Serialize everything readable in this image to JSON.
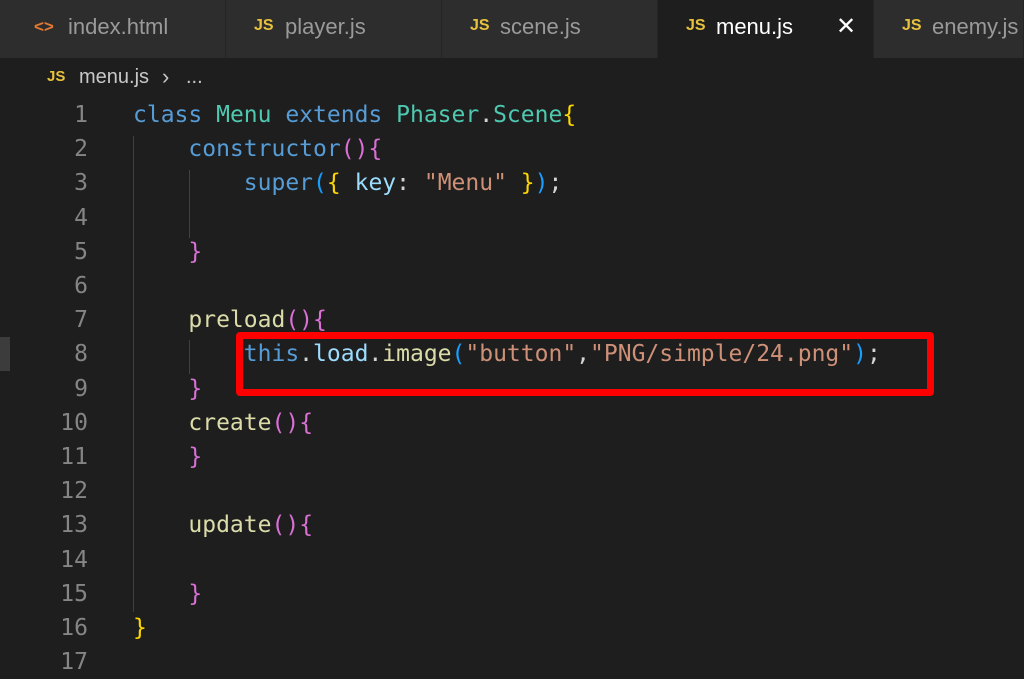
{
  "tabs": [
    {
      "label": "index.html",
      "icon": "<>",
      "icon_name": "html-file-icon"
    },
    {
      "label": "player.js",
      "icon": "JS",
      "icon_name": "js-file-icon"
    },
    {
      "label": "scene.js",
      "icon": "JS",
      "icon_name": "js-file-icon"
    },
    {
      "label": "menu.js",
      "icon": "JS",
      "icon_name": "js-file-icon",
      "active": true,
      "close": "✕"
    },
    {
      "label": "enemy.js",
      "icon": "JS",
      "icon_name": "js-file-icon"
    }
  ],
  "breadcrumb": {
    "icon": "JS",
    "file": "menu.js",
    "separator": "›",
    "more": "..."
  },
  "lines": [
    {
      "n": "1",
      "tokens": [
        [
          "kw",
          "class "
        ],
        [
          "cls",
          "Menu "
        ],
        [
          "kw",
          "extends "
        ],
        [
          "cls",
          "Phaser"
        ],
        [
          "punc",
          "."
        ],
        [
          "cls",
          "Scene"
        ],
        [
          "b1",
          "{"
        ]
      ]
    },
    {
      "n": "2",
      "tokens": [
        [
          "punc",
          "    "
        ],
        [
          "kw",
          "constructor"
        ],
        [
          "b2",
          "()"
        ],
        [
          "b2",
          "{"
        ]
      ]
    },
    {
      "n": "3",
      "tokens": [
        [
          "punc",
          "        "
        ],
        [
          "kw",
          "super"
        ],
        [
          "b3",
          "("
        ],
        [
          "b1",
          "{ "
        ],
        [
          "prop",
          "key"
        ],
        [
          "punc",
          ": "
        ],
        [
          "str",
          "\"Menu\""
        ],
        [
          "b1",
          " }"
        ],
        [
          "b3",
          ")"
        ],
        [
          "punc",
          ";"
        ]
      ]
    },
    {
      "n": "4",
      "tokens": []
    },
    {
      "n": "5",
      "tokens": [
        [
          "punc",
          "    "
        ],
        [
          "b2",
          "}"
        ]
      ]
    },
    {
      "n": "6",
      "tokens": []
    },
    {
      "n": "7",
      "tokens": [
        [
          "punc",
          "    "
        ],
        [
          "fn",
          "preload"
        ],
        [
          "b2",
          "()"
        ],
        [
          "b2",
          "{"
        ]
      ]
    },
    {
      "n": "8",
      "tokens": [
        [
          "punc",
          "        "
        ],
        [
          "kw",
          "this"
        ],
        [
          "punc",
          "."
        ],
        [
          "prop",
          "load"
        ],
        [
          "punc",
          "."
        ],
        [
          "fn",
          "image"
        ],
        [
          "b3",
          "("
        ],
        [
          "str",
          "\"button\""
        ],
        [
          "punc",
          ","
        ],
        [
          "str",
          "\"PNG/simple/24.png\""
        ],
        [
          "b3",
          ")"
        ],
        [
          "punc",
          ";"
        ]
      ]
    },
    {
      "n": "9",
      "tokens": [
        [
          "punc",
          "    "
        ],
        [
          "b2",
          "}"
        ]
      ]
    },
    {
      "n": "10",
      "tokens": [
        [
          "punc",
          "    "
        ],
        [
          "fn",
          "create"
        ],
        [
          "b2",
          "()"
        ],
        [
          "b2",
          "{"
        ]
      ]
    },
    {
      "n": "11",
      "tokens": [
        [
          "punc",
          "    "
        ],
        [
          "b2",
          "}"
        ]
      ]
    },
    {
      "n": "12",
      "tokens": []
    },
    {
      "n": "13",
      "tokens": [
        [
          "punc",
          "    "
        ],
        [
          "fn",
          "update"
        ],
        [
          "b2",
          "()"
        ],
        [
          "b2",
          "{"
        ]
      ]
    },
    {
      "n": "14",
      "tokens": []
    },
    {
      "n": "15",
      "tokens": [
        [
          "punc",
          "    "
        ],
        [
          "b2",
          "}"
        ]
      ]
    },
    {
      "n": "16",
      "tokens": [
        [
          "b1",
          "}"
        ]
      ]
    },
    {
      "n": "17",
      "tokens": []
    }
  ],
  "colors": {
    "highlight_box": "#ff0000",
    "js_icon": "#e8c13d",
    "html_icon": "#e37933"
  }
}
